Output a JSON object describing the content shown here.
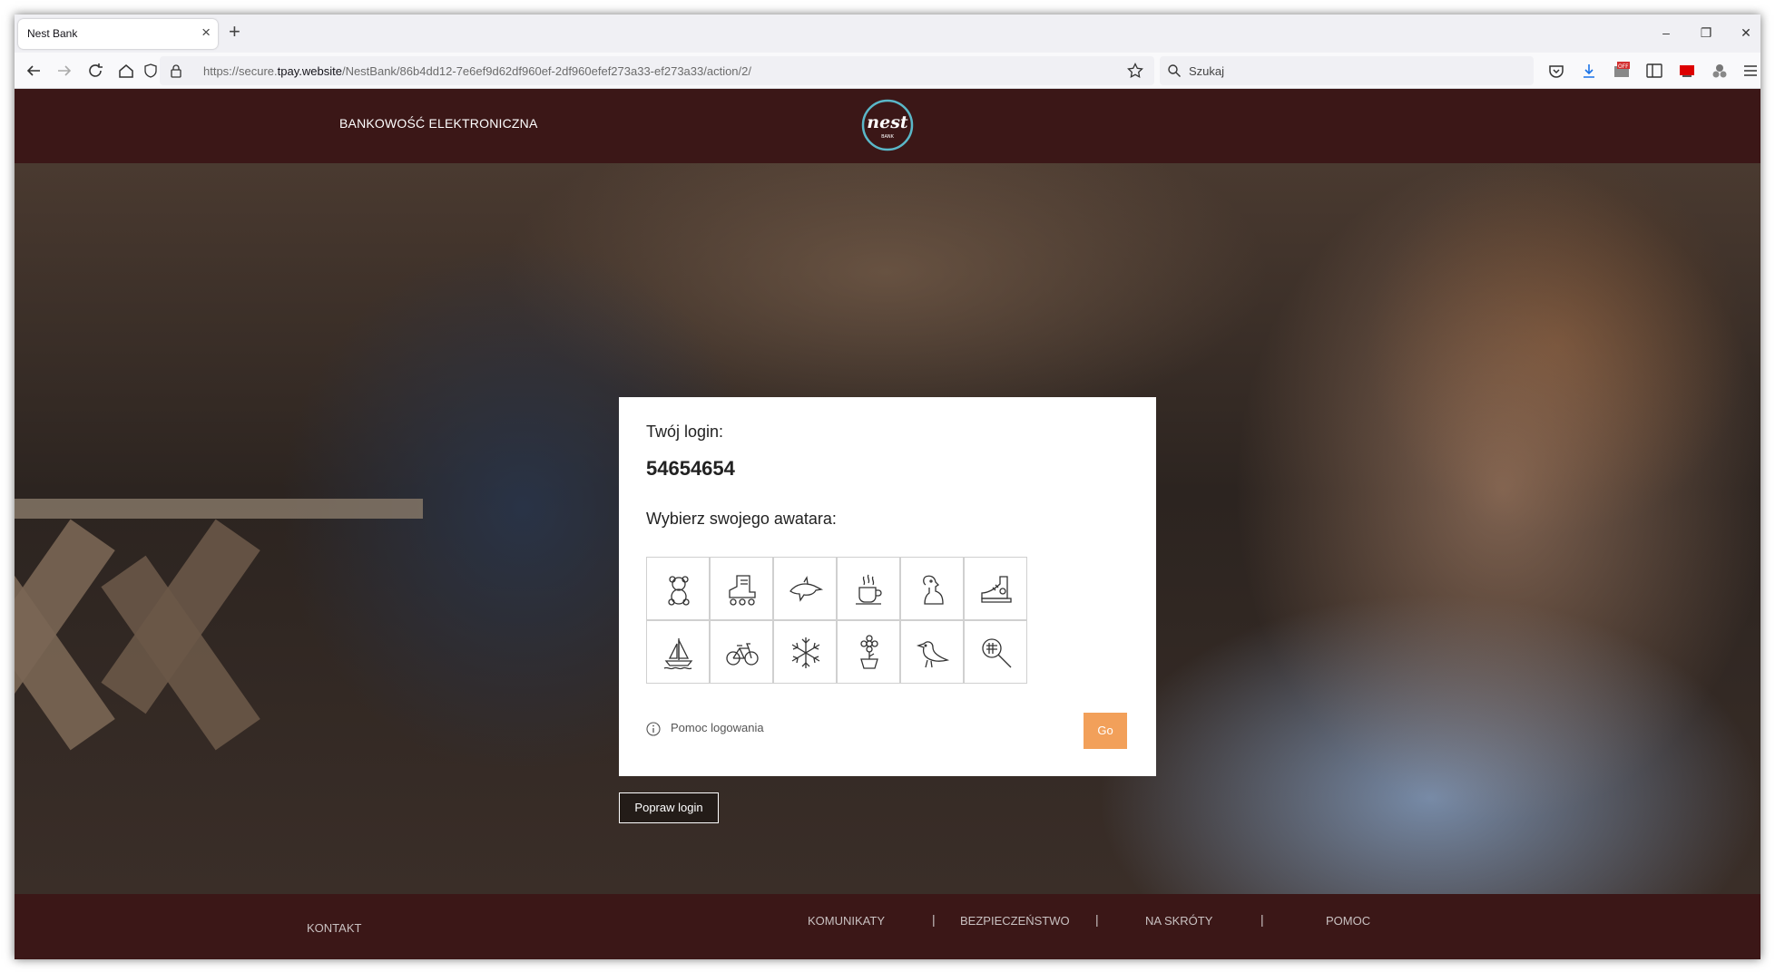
{
  "browser": {
    "tab_title": "Nest Bank",
    "url_prefix": "https://secure.",
    "url_domain": "tpay.website",
    "url_path": "/NestBank/86b4dd12-7e6ef9d62df960ef-2df960efef273a33-ef273a33/action/2/",
    "search_placeholder": "Szukaj"
  },
  "header": {
    "brand_text": "BANKOWOŚĆ ELEKTRONICZNA",
    "logo_text": "nest",
    "logo_subtext": "BANK"
  },
  "login": {
    "label": "Twój login:",
    "value": "54654654",
    "avatar_prompt": "Wybierz swojego awatara:",
    "avatars": [
      "teddy-bear",
      "roller-skate",
      "dolphin",
      "coffee-cup",
      "dog",
      "sneaker",
      "sailboat",
      "bicycle",
      "snowflake",
      "flower-pot",
      "bird",
      "magnifier"
    ],
    "help_text": "Pomoc logowania",
    "go_label": "Go",
    "fix_login_label": "Popraw login"
  },
  "footer": {
    "contact": "KONTAKT",
    "links": [
      "KOMUNIKATY",
      "BEZPIECZEŃSTWO",
      "NA SKRÓTY",
      "POMOC"
    ],
    "separator": "|"
  },
  "colors": {
    "brand_maroon": "#3b1717",
    "go_orange": "#f2a05a",
    "logo_teal": "#5ab7c8"
  }
}
